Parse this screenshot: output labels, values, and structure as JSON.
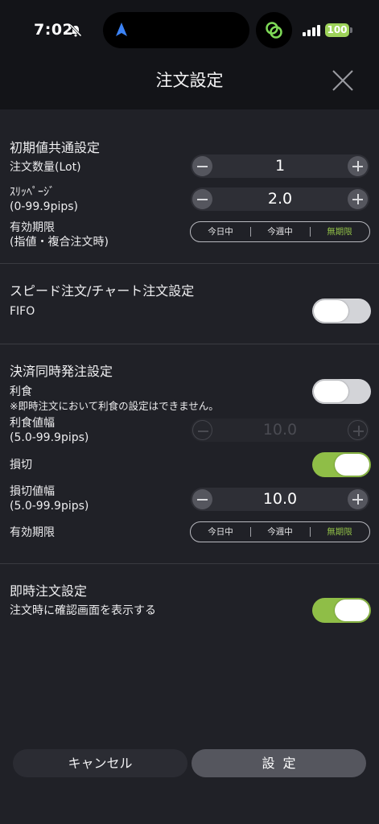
{
  "status_bar": {
    "time": "7:02",
    "battery": "100"
  },
  "header": {
    "title": "注文設定"
  },
  "section_initial": {
    "title": "初期値共通設定",
    "order_qty_label": "注文数量(Lot)",
    "order_qty_value": "1",
    "slippage_label_line1": "ｽﾘｯﾍﾟｰｼﾞ",
    "slippage_label_line2": "(0-99.9pips)",
    "slippage_value": "2.0",
    "expiry_label_line1": "有効期限",
    "expiry_label_line2": "(指値・複合注文時)",
    "expiry_options": [
      "今日中",
      "今週中",
      "無期限"
    ],
    "expiry_selected": "無期限"
  },
  "section_speed": {
    "title": "スピード注文/チャート注文設定",
    "fifo_label": "FIFO",
    "fifo_on": false
  },
  "section_settlement": {
    "title": "決済同時発注設定",
    "take_profit_label": "利食",
    "take_profit_note": "※即時注文において利食の設定はできません。",
    "take_profit_on": false,
    "take_profit_width_label_line1": "利食値幅",
    "take_profit_width_label_line2": "(5.0-99.9pips)",
    "take_profit_width_value": "10.0",
    "stop_loss_label": "損切",
    "stop_loss_on": true,
    "stop_loss_width_label_line1": "損切値幅",
    "stop_loss_width_label_line2": "(5.0-99.9pips)",
    "stop_loss_width_value": "10.0",
    "expiry_label": "有効期限",
    "expiry_options": [
      "今日中",
      "今週中",
      "無期限"
    ],
    "expiry_selected": "無期限"
  },
  "section_instant": {
    "title": "即時注文設定",
    "confirm_label": "注文時に確認画面を表示する",
    "confirm_on": true
  },
  "footer": {
    "cancel_label": "キャンセル",
    "confirm_label": "設定"
  },
  "colors": {
    "accent": "#8fbe47",
    "background": "#202127",
    "header": "#131418"
  }
}
